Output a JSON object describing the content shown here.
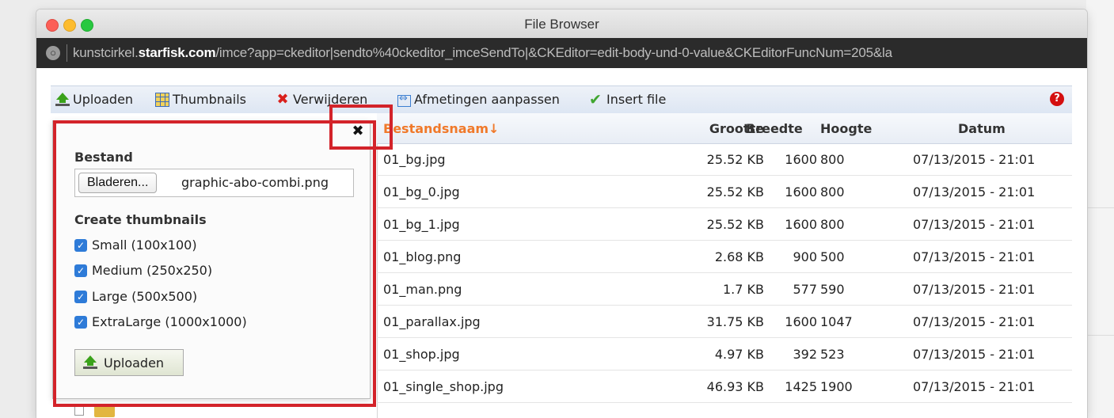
{
  "window": {
    "title": "File Browser",
    "url": {
      "prefix": "kunstcirkel.",
      "host": "starfisk.com",
      "path": "/imce?app=ckeditor|sendto%40ckeditor_imceSendTo|&CKEditor=edit-body-und-0-value&CKEditorFuncNum=205&la"
    }
  },
  "toolbar": {
    "items": [
      {
        "label": "Uploaden",
        "icon": "upload-icon"
      },
      {
        "label": "Thumbnails",
        "icon": "thumbnails-icon"
      },
      {
        "label": "Verwijderen",
        "icon": "delete-x-icon"
      },
      {
        "label": "Afmetingen aanpassen",
        "icon": "resize-icon"
      },
      {
        "label": "Insert file",
        "icon": "checkmark-icon"
      }
    ],
    "help_icon": "help-icon",
    "help_glyph": "?"
  },
  "table": {
    "columns": {
      "name": "Bestandsnaam↓",
      "size": "Grootte",
      "width": "Breedte",
      "height": "Hoogte",
      "date": "Datum"
    },
    "rows": [
      {
        "name": "01_bg.jpg",
        "size": "25.52 KB",
        "width": "1600",
        "height": "800",
        "date": "07/13/2015 - 21:01"
      },
      {
        "name": "01_bg_0.jpg",
        "size": "25.52 KB",
        "width": "1600",
        "height": "800",
        "date": "07/13/2015 - 21:01"
      },
      {
        "name": "01_bg_1.jpg",
        "size": "25.52 KB",
        "width": "1600",
        "height": "800",
        "date": "07/13/2015 - 21:01"
      },
      {
        "name": "01_blog.png",
        "size": "2.68 KB",
        "width": "900",
        "height": "500",
        "date": "07/13/2015 - 21:01"
      },
      {
        "name": "01_man.png",
        "size": "1.7 KB",
        "width": "577",
        "height": "590",
        "date": "07/13/2015 - 21:01"
      },
      {
        "name": "01_parallax.jpg",
        "size": "31.75 KB",
        "width": "1600",
        "height": "1047",
        "date": "07/13/2015 - 21:01"
      },
      {
        "name": "01_shop.jpg",
        "size": "4.97 KB",
        "width": "392",
        "height": "523",
        "date": "07/13/2015 - 21:01"
      },
      {
        "name": "01_single_shop.jpg",
        "size": "46.93 KB",
        "width": "1425",
        "height": "1900",
        "date": "07/13/2015 - 21:01"
      }
    ]
  },
  "upload_dialog": {
    "close_glyph": "✖",
    "file_label": "Bestand",
    "browse_label": "Bladeren...",
    "file_name": "graphic-abo-combi.png",
    "thumbnails_label": "Create thumbnails",
    "thumbnail_options": [
      {
        "label": "Small (100x100)",
        "checked": true
      },
      {
        "label": "Medium (250x250)",
        "checked": true
      },
      {
        "label": "Large (500x500)",
        "checked": true
      },
      {
        "label": "ExtraLarge (1000x1000)",
        "checked": true
      }
    ],
    "submit_label": "Uploaden"
  },
  "colors": {
    "annotation_red": "#d3232a",
    "sort_header_orange": "#f0792a",
    "checkbox_blue": "#2e7bd8"
  }
}
